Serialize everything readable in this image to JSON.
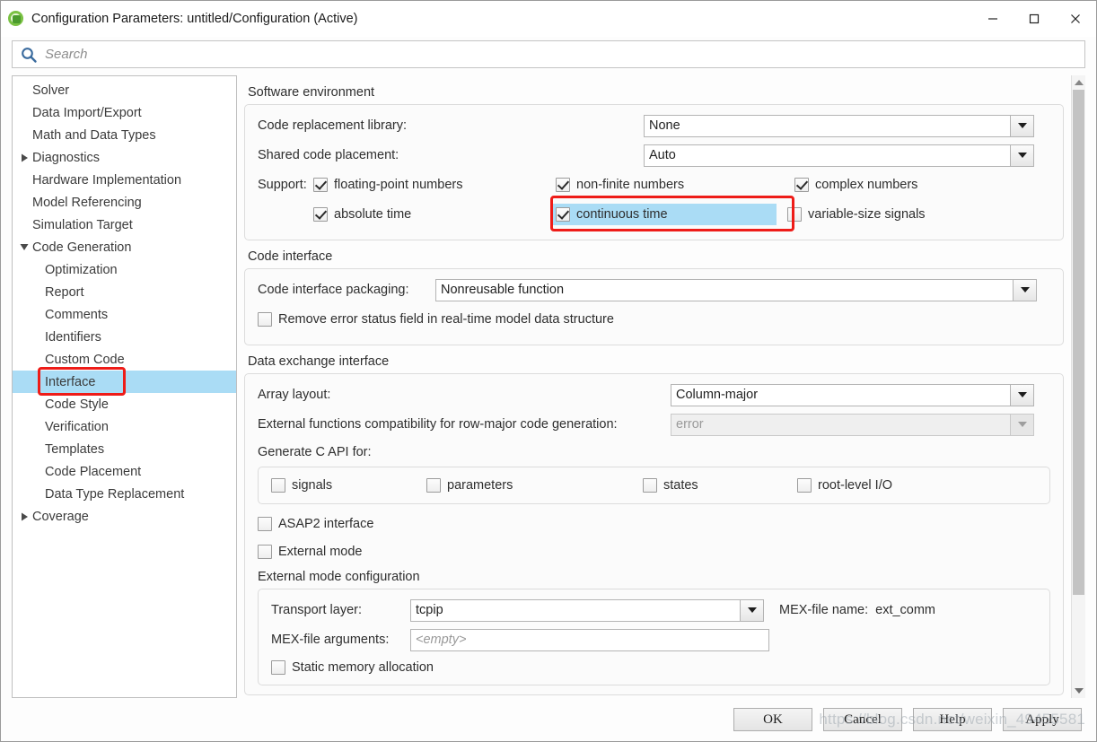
{
  "window": {
    "title": "Configuration Parameters: untitled/Configuration (Active)",
    "app_icon": "simulink-icon",
    "minimize_label": "—",
    "maximize_label": "□",
    "close_label": "✕",
    "accent_highlight": "#aadcf5",
    "annotation_color": "#ee1c18"
  },
  "search": {
    "placeholder": "Search",
    "value": "",
    "icon": "search-icon"
  },
  "sidebar": {
    "items": [
      {
        "label": "Solver",
        "level": 0,
        "twisty": "",
        "selected": false
      },
      {
        "label": "Data Import/Export",
        "level": 0,
        "twisty": "",
        "selected": false
      },
      {
        "label": "Math and Data Types",
        "level": 0,
        "twisty": "",
        "selected": false
      },
      {
        "label": "Diagnostics",
        "level": 0,
        "twisty": "collapsed",
        "selected": false
      },
      {
        "label": "Hardware Implementation",
        "level": 0,
        "twisty": "",
        "selected": false
      },
      {
        "label": "Model Referencing",
        "level": 0,
        "twisty": "",
        "selected": false
      },
      {
        "label": "Simulation Target",
        "level": 0,
        "twisty": "",
        "selected": false
      },
      {
        "label": "Code Generation",
        "level": 0,
        "twisty": "expanded",
        "selected": false
      },
      {
        "label": "Optimization",
        "level": 1,
        "twisty": "",
        "selected": false
      },
      {
        "label": "Report",
        "level": 1,
        "twisty": "",
        "selected": false
      },
      {
        "label": "Comments",
        "level": 1,
        "twisty": "",
        "selected": false
      },
      {
        "label": "Identifiers",
        "level": 1,
        "twisty": "",
        "selected": false
      },
      {
        "label": "Custom Code",
        "level": 1,
        "twisty": "",
        "selected": false
      },
      {
        "label": "Interface",
        "level": 1,
        "twisty": "",
        "selected": true
      },
      {
        "label": "Code Style",
        "level": 1,
        "twisty": "",
        "selected": false
      },
      {
        "label": "Verification",
        "level": 1,
        "twisty": "",
        "selected": false
      },
      {
        "label": "Templates",
        "level": 1,
        "twisty": "",
        "selected": false
      },
      {
        "label": "Code Placement",
        "level": 1,
        "twisty": "",
        "selected": false
      },
      {
        "label": "Data Type Replacement",
        "level": 1,
        "twisty": "",
        "selected": false
      },
      {
        "label": "Coverage",
        "level": 0,
        "twisty": "collapsed",
        "selected": false
      }
    ]
  },
  "software_environment": {
    "title": "Software environment",
    "code_replacement_library": {
      "label": "Code replacement library:",
      "value": "None"
    },
    "shared_code_placement": {
      "label": "Shared code placement:",
      "value": "Auto"
    },
    "support_label": "Support:",
    "support_options": [
      {
        "label": "floating-point numbers",
        "checked": true,
        "highlighted": false
      },
      {
        "label": "non-finite numbers",
        "checked": true,
        "highlighted": false
      },
      {
        "label": "complex numbers",
        "checked": true,
        "highlighted": false
      },
      {
        "label": "absolute time",
        "checked": true,
        "highlighted": false
      },
      {
        "label": "continuous time",
        "checked": true,
        "highlighted": true
      },
      {
        "label": "variable-size signals",
        "checked": false,
        "highlighted": false
      }
    ]
  },
  "code_interface": {
    "title": "Code interface",
    "packaging": {
      "label": "Code interface packaging:",
      "value": "Nonreusable function"
    },
    "remove_error_status": {
      "label": "Remove error status field in real-time model data structure",
      "checked": false
    }
  },
  "data_exchange": {
    "title": "Data exchange interface",
    "array_layout": {
      "label": "Array layout:",
      "value": "Column-major"
    },
    "row_major_compat": {
      "label": "External functions compatibility for row-major code generation:",
      "value": "error",
      "disabled": true
    },
    "generate_c_api_label": "Generate C API for:",
    "c_api_options": [
      {
        "label": "signals",
        "checked": false
      },
      {
        "label": "parameters",
        "checked": false
      },
      {
        "label": "states",
        "checked": false
      },
      {
        "label": "root-level I/O",
        "checked": false
      }
    ],
    "asap2_interface": {
      "label": "ASAP2 interface",
      "checked": false
    },
    "external_mode": {
      "label": "External mode",
      "checked": false
    }
  },
  "external_mode_config": {
    "title": "External mode configuration",
    "transport_layer": {
      "label": "Transport layer:",
      "value": "tcpip"
    },
    "mex_file_name": {
      "label": "MEX-file name:",
      "value": "ext_comm"
    },
    "mex_file_arguments": {
      "label": "MEX-file arguments:",
      "value": "",
      "placeholder": "<empty>"
    },
    "static_memory_allocation": {
      "label": "Static memory allocation",
      "checked": false
    }
  },
  "footer": {
    "ok": "OK",
    "cancel": "Cancel",
    "help": "Help",
    "apply": "Apply",
    "watermark": "https://blog.csdn.net/weixin_49455581"
  }
}
